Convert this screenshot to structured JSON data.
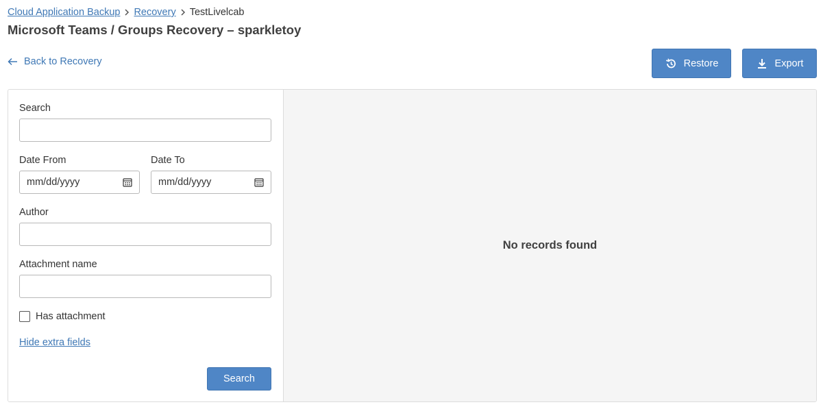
{
  "breadcrumb": {
    "items": [
      "Cloud Application Backup",
      "Recovery"
    ],
    "current": "TestLivelcab"
  },
  "page_title": "Microsoft Teams / Groups Recovery – sparkletoy",
  "back_link": "Back to Recovery",
  "actions": {
    "restore_label": "Restore",
    "export_label": "Export"
  },
  "filters": {
    "search_label": "Search",
    "search_value": "",
    "date_from_label": "Date From",
    "date_from_placeholder": "mm/dd/yyyy",
    "date_to_label": "Date To",
    "date_to_placeholder": "mm/dd/yyyy",
    "author_label": "Author",
    "author_value": "",
    "attachment_name_label": "Attachment name",
    "attachment_name_value": "",
    "has_attachment_label": "Has attachment",
    "has_attachment_checked": false,
    "hide_extra_fields_label": "Hide extra fields",
    "search_button_label": "Search"
  },
  "results": {
    "empty_message": "No records found"
  },
  "icons": {
    "breadcrumb_separator": "chevron-right-icon",
    "back": "arrow-left-icon",
    "restore": "restore-history-icon",
    "export": "download-icon",
    "calendar": "calendar-icon"
  },
  "colors": {
    "primary": "#4f86c6",
    "link": "#3f78b5",
    "results_background": "#f5f5f5"
  }
}
